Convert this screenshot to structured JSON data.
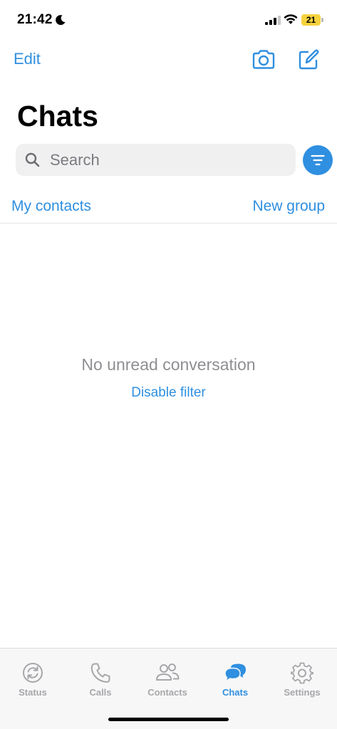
{
  "status_bar": {
    "time": "21:42",
    "battery": "21"
  },
  "nav": {
    "edit_label": "Edit"
  },
  "page_title": "Chats",
  "search": {
    "placeholder": "Search"
  },
  "contacts_row": {
    "my_contacts": "My contacts",
    "new_group": "New group"
  },
  "empty_state": {
    "message": "No unread conversation",
    "action": "Disable filter"
  },
  "tabs": [
    {
      "label": "Status",
      "icon": "status-icon",
      "active": false
    },
    {
      "label": "Calls",
      "icon": "phone-icon",
      "active": false
    },
    {
      "label": "Contacts",
      "icon": "contacts-icon",
      "active": false
    },
    {
      "label": "Chats",
      "icon": "chats-icon",
      "active": true
    },
    {
      "label": "Settings",
      "icon": "gear-icon",
      "active": false
    }
  ],
  "colors": {
    "accent": "#2f8fe0",
    "inactive": "#a7a7ab",
    "battery": "#f6d23d"
  }
}
